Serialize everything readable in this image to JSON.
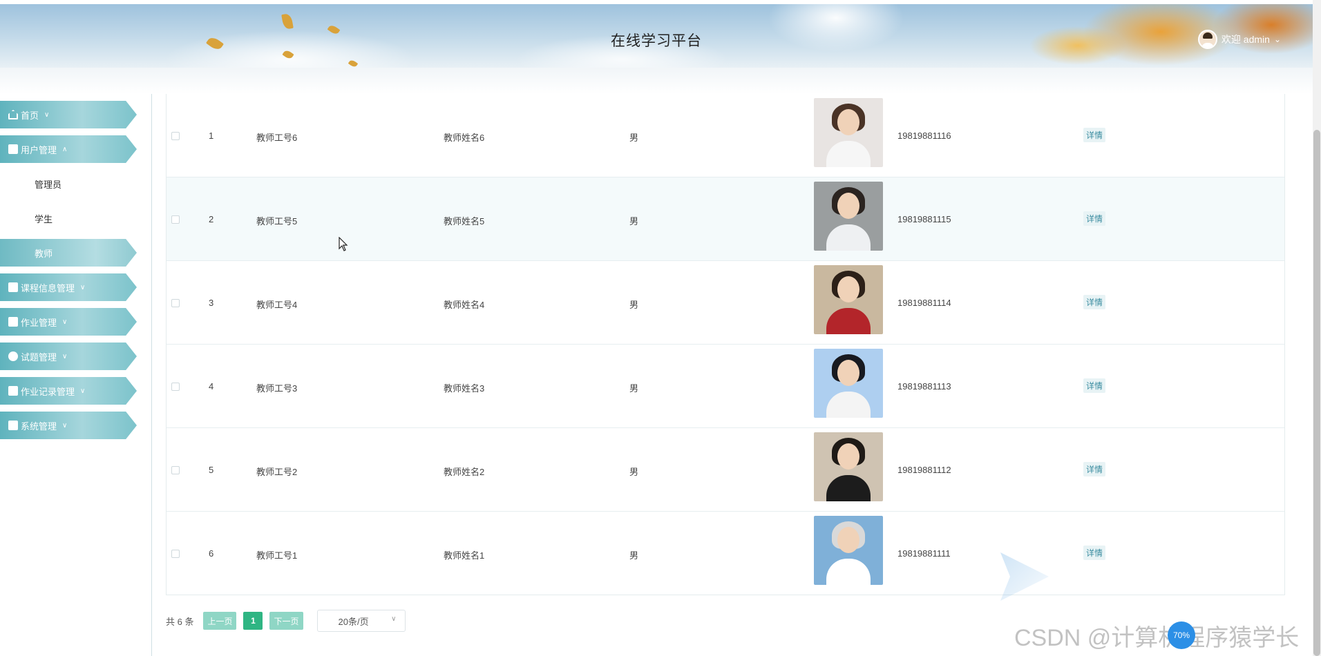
{
  "header": {
    "title": "在线学习平台",
    "user_label": "欢迎 admin"
  },
  "sidebar": {
    "items": [
      {
        "label": "首页",
        "icon": "home-icon"
      },
      {
        "label": "用户管理",
        "icon": "user-icon"
      },
      {
        "label": "课程信息管理",
        "icon": "grid-icon"
      },
      {
        "label": "作业管理",
        "icon": "folder-icon"
      },
      {
        "label": "试题管理",
        "icon": "check-circle-icon"
      },
      {
        "label": "作业记录管理",
        "icon": "user-icon"
      },
      {
        "label": "系统管理",
        "icon": "settings-icon"
      }
    ],
    "submenu": [
      {
        "label": "管理员"
      },
      {
        "label": "学生"
      },
      {
        "label": "教师"
      }
    ]
  },
  "table": {
    "rows": [
      {
        "index": "1",
        "emp_no": "教师工号6",
        "name": "教师姓名6",
        "gender": "男",
        "phone": "19819881116",
        "action": "详情"
      },
      {
        "index": "2",
        "emp_no": "教师工号5",
        "name": "教师姓名5",
        "gender": "男",
        "phone": "19819881115",
        "action": "详情"
      },
      {
        "index": "3",
        "emp_no": "教师工号4",
        "name": "教师姓名4",
        "gender": "男",
        "phone": "19819881114",
        "action": "详情"
      },
      {
        "index": "4",
        "emp_no": "教师工号3",
        "name": "教师姓名3",
        "gender": "男",
        "phone": "19819881113",
        "action": "详情"
      },
      {
        "index": "5",
        "emp_no": "教师工号2",
        "name": "教师姓名2",
        "gender": "男",
        "phone": "19819881112",
        "action": "详情"
      },
      {
        "index": "6",
        "emp_no": "教师工号1",
        "name": "教师姓名1",
        "gender": "男",
        "phone": "19819881111",
        "action": "详情"
      }
    ]
  },
  "pagination": {
    "total": "共 6 条",
    "prev": "上一页",
    "current_page": "1",
    "next": "下一页",
    "page_size": "20条/页"
  },
  "watermark": {
    "text": "CSDN @计算机程序猿学长",
    "badge": "70%"
  },
  "colors": {
    "accent": "#2fb583",
    "menu": "#6fbac3",
    "detail": "#3a8ca0"
  }
}
